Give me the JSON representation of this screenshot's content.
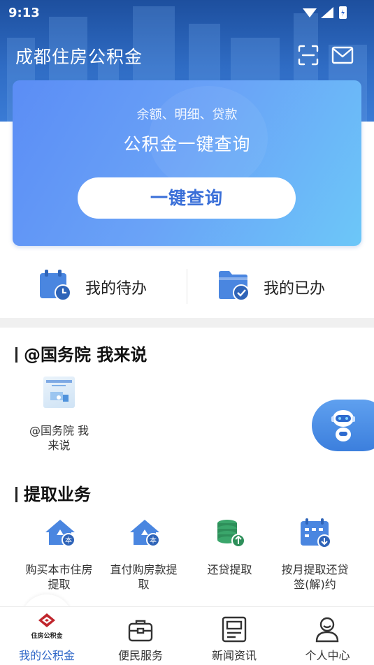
{
  "status": {
    "time": "9:13"
  },
  "header": {
    "title": "成都住房公积金",
    "scan_icon": "scan-icon",
    "mail_icon": "mail-icon"
  },
  "query_card": {
    "subtitle": "余额、明细、贷款",
    "title": "公积金一键查询",
    "button": "一键查询"
  },
  "tasks": [
    {
      "label": "我的待办",
      "icon": "calendar-clock-icon"
    },
    {
      "label": "我的已办",
      "icon": "folder-check-icon"
    }
  ],
  "section_news": {
    "title": "@国务院 我来说",
    "items": [
      {
        "caption_line1": "@国务院 我",
        "caption_line2": "来说"
      }
    ]
  },
  "section_withdraw": {
    "title": "提取业务",
    "items": [
      {
        "line1": "购买本市住房",
        "line2": "提取",
        "icon": "house-icon"
      },
      {
        "line1": "直付购房款提",
        "line2": "取",
        "icon": "house-icon"
      },
      {
        "line1": "还贷提取",
        "line2": "",
        "icon": "coins-icon"
      },
      {
        "line1": "按月提取还贷",
        "line2": "签(解)约",
        "icon": "calendar-download-icon"
      }
    ]
  },
  "tabbar": [
    {
      "label": "我的公积金",
      "active": true,
      "logo_text": "住房公积金"
    },
    {
      "label": "便民服务",
      "active": false
    },
    {
      "label": "新闻资讯",
      "active": false
    },
    {
      "label": "个人中心",
      "active": false
    }
  ],
  "colors": {
    "primary": "#3068c8",
    "card_start": "#5b8df5",
    "card_end": "#6cc7f8",
    "icon_blue": "#4a86e0",
    "icon_green": "#3aa66b"
  }
}
